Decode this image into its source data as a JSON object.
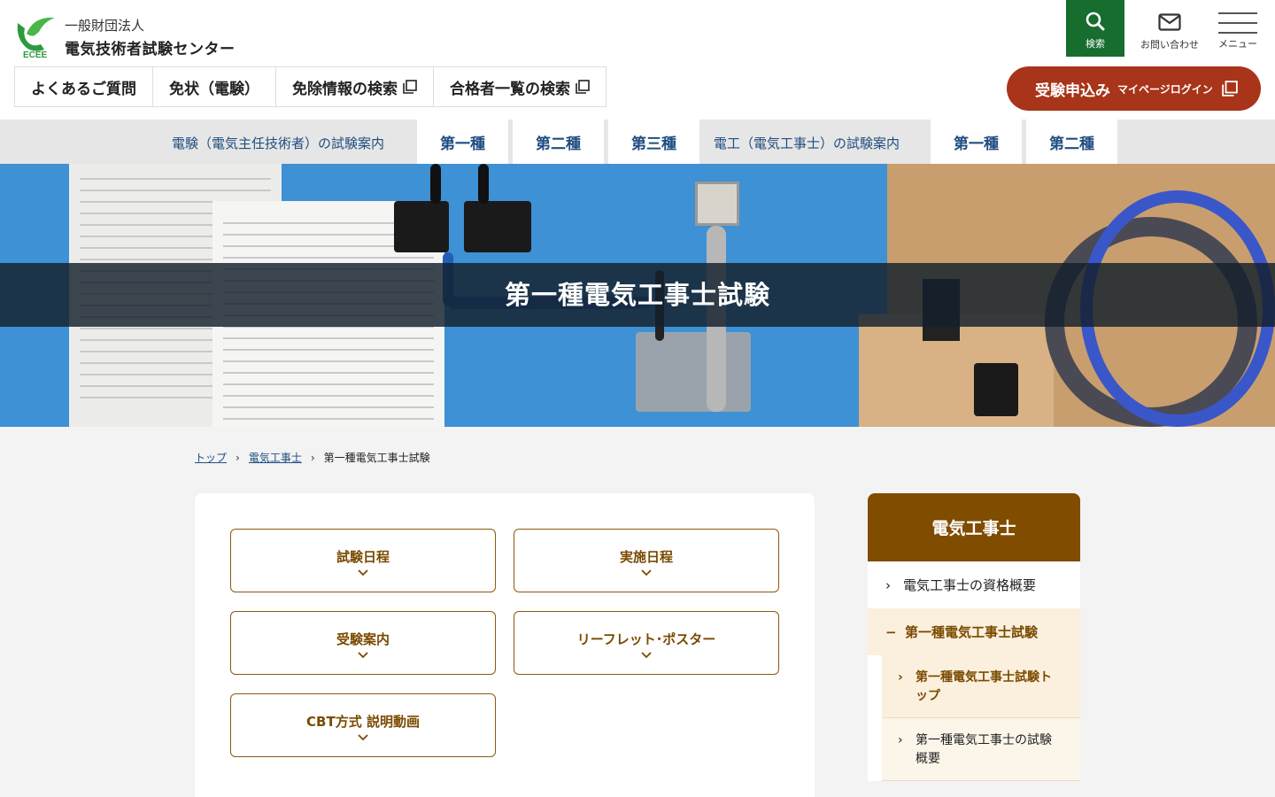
{
  "header": {
    "logo_sub": "一般財団法人",
    "logo_main": "電気技術者試験センター",
    "logo_text": "ECEE",
    "search_label": "検索",
    "contact_label": "お問い合わせ",
    "menu_label": "メニュー",
    "brand_color": "#166d2e",
    "subnav": [
      {
        "label": "よくあるご質問"
      },
      {
        "label": "免状（電験）"
      },
      {
        "label": "免除情報の検索"
      },
      {
        "label": "合格者一覧の検索"
      }
    ],
    "apply_main": "受験申込み",
    "apply_sub": "マイページログイン",
    "apply_color": "#a8341a"
  },
  "categories": {
    "denken_label": "電験（電気主任技術者）の試験案内",
    "denken_tabs": [
      "第一種",
      "第二種",
      "第三種"
    ],
    "denko_label": "電工（電気工事士）の試験案内",
    "denko_tabs": [
      "第一種",
      "第二種"
    ]
  },
  "hero": {
    "title": "第一種電気工事士試験"
  },
  "breadcrumb": {
    "items": [
      "トップ",
      "電気工事士"
    ],
    "current": "第一種電気工事士試験"
  },
  "anchors": [
    {
      "label": "試験日程"
    },
    {
      "label": "実施日程"
    },
    {
      "label": "受験案内"
    },
    {
      "label": "リーフレット･ポスター"
    },
    {
      "label": "CBT方式 説明動画"
    }
  ],
  "side": {
    "title": "電気工事士",
    "accent": "#7f4c00",
    "items": [
      {
        "label": "電気工事士の資格概要"
      },
      {
        "label": "第一種電気工事士試験"
      }
    ],
    "sub_items": [
      {
        "label": "第一種電気工事士試験トップ"
      },
      {
        "label": "第一種電気工事士の試験概要"
      }
    ]
  }
}
